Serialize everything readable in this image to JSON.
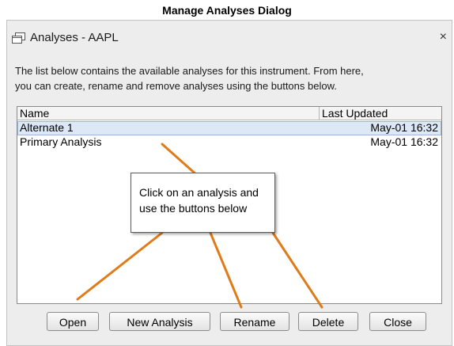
{
  "heading": "Manage Analyses Dialog",
  "dialog": {
    "title": "Analyses - AAPL",
    "close_glyph": "×",
    "description": [
      "The list below contains the available analyses for this instrument. From here,",
      "you can create, rename and remove analyses using the buttons below."
    ],
    "table": {
      "columns": [
        "Name",
        "Last Updated"
      ],
      "rows": [
        {
          "name": "Alternate 1",
          "updated": "May-01 16:32",
          "selected": true
        },
        {
          "name": "Primary Analysis",
          "updated": "May-01 16:32",
          "selected": false
        }
      ]
    },
    "buttons": {
      "open": "Open",
      "new_analysis": "New Analysis",
      "rename": "Rename",
      "delete": "Delete",
      "close": "Close"
    }
  },
  "callout": {
    "lines": [
      "Click on an analysis and",
      "use the buttons below"
    ]
  },
  "icons": {
    "window": "window-icon",
    "close": "close-icon"
  },
  "colors": {
    "dialog_bg": "#ededed",
    "selection": "#dde8f5",
    "arrow": "#e07b1a"
  }
}
